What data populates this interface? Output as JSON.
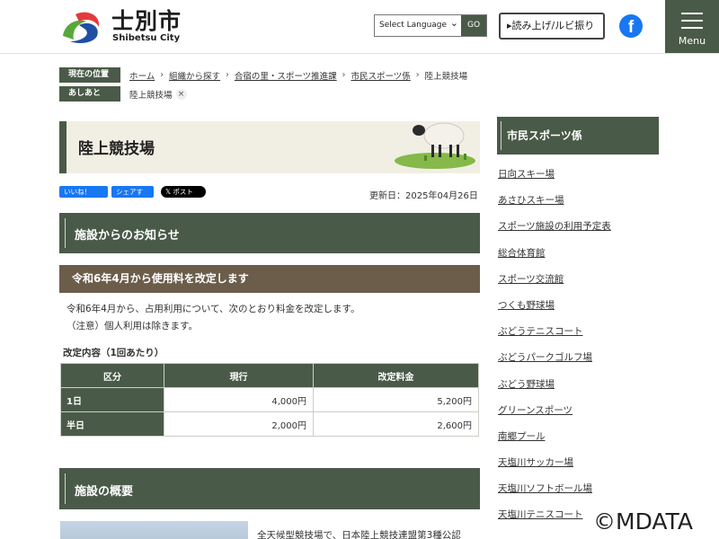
{
  "header": {
    "logo_title": "士別市",
    "logo_sub": "Shibetsu City",
    "language_select": "Select Language",
    "go_label": "GO",
    "read_label": "▸読み上げ/ルビ振り",
    "facebook_glyph": "f",
    "menu_label": "Menu"
  },
  "breadcrumb": {
    "current_tag": "現在の位置",
    "items": [
      "ホーム",
      "組織から探す",
      "合宿の里・スポーツ推進課",
      "市民スポーツ係",
      "陸上競技場"
    ],
    "footprint_tag": "あしあと",
    "footprint_item": "陸上競技場",
    "footprint_close": "×"
  },
  "main": {
    "page_title": "陸上競技場",
    "social": {
      "like": "いいね！",
      "share": "シェアする",
      "post": "ポスト"
    },
    "updated": "更新日：2025年04月26日",
    "section1": "施設からのお知らせ",
    "notice_title": "令和6年4月から使用料を改定します",
    "notice_p1": "令和6年4月から、占用利用について、次のとおり料金を改定します。",
    "notice_p2": "（注意）個人利用は除きます。",
    "table_caption": "改定内容（1回あたり）",
    "table": {
      "headers": [
        "区分",
        "現行",
        "改定料金"
      ],
      "rows": [
        [
          "1日",
          "4,000円",
          "5,200円"
        ],
        [
          "半日",
          "2,000円",
          "2,600円"
        ]
      ]
    },
    "section2": "施設の概要",
    "facility_text": "全天候型競技場で、日本陸上競技連盟第3種公認"
  },
  "sidebar": {
    "title": "市民スポーツ係",
    "links": [
      "日向スキー場",
      "あさひスキー場",
      "スポーツ施設の利用予定表",
      "総合体育館",
      "スポーツ交流館",
      "つくも野球場",
      "ぶどうテニスコート",
      "ぶどうパークゴルフ場",
      "ぶどう野球場",
      "グリーンスポーツ",
      "南郷プール",
      "天塩川サッカー場",
      "天塩川ソフトボール場",
      "天塩川テニスコート"
    ]
  },
  "watermark": "©MDATA",
  "colors": {
    "primary": "#4a5a48",
    "accent_brown": "#6b5d4a",
    "title_bg": "#f1efe4"
  }
}
